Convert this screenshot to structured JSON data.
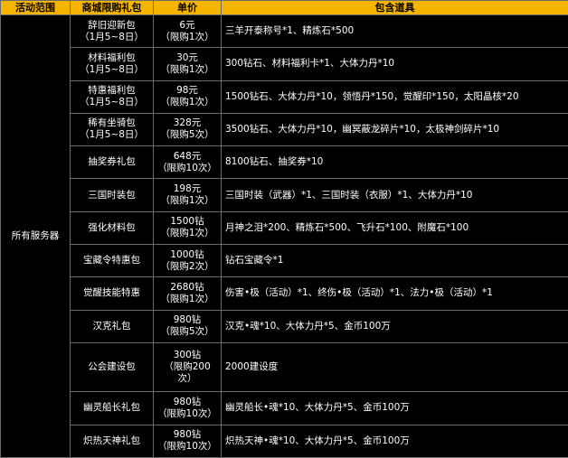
{
  "headers": [
    "活动范围",
    "商城限购礼包",
    "单价",
    "包含道具"
  ],
  "scope": "所有服务器",
  "rows": [
    {
      "name": [
        "辞旧迎新包",
        "（1月5~8日）"
      ],
      "price": [
        "6元",
        "（限购1次）"
      ],
      "items": "三羊开泰称号*1、精炼石*500"
    },
    {
      "name": [
        "材料福利包",
        "（1月5~8日）"
      ],
      "price": [
        "30元",
        "（限购1次）"
      ],
      "items": "300钻石、材料福利卡*1、大体力丹*10"
    },
    {
      "name": [
        "特惠福利包",
        "（1月5~8日）"
      ],
      "price": [
        "98元",
        "（限购1次）"
      ],
      "items": "1500钻石、大体力丹*10，领悟丹*150，觉醒印*150，太阳晶核*20"
    },
    {
      "name": [
        "稀有坐骑包",
        "（1月5~8日）"
      ],
      "price": [
        "328元",
        "（限购5次）"
      ],
      "items": "3500钻石、大体力丹*10，幽冥蔽龙碎片*10，太极神剑碎片*10"
    },
    {
      "name": [
        "抽奖券礼包"
      ],
      "price": [
        "648元",
        "（限购10次）"
      ],
      "items": "8100钻石、抽奖券*10"
    },
    {
      "name": [
        "三国时装包"
      ],
      "price": [
        "198元",
        "（限购1次）"
      ],
      "items": "三国时装（武器）*1、三国时装（衣服）*1、大体力丹*10"
    },
    {
      "name": [
        "强化材料包"
      ],
      "price": [
        "1500钻",
        "（限购1次）"
      ],
      "items": "月神之泪*200、精炼石*500、飞升石*100、附魔石*100"
    },
    {
      "name": [
        "宝藏令特惠包"
      ],
      "price": [
        "1000钻",
        "（限购2次）"
      ],
      "items": "钻石宝藏令*1"
    },
    {
      "name": [
        "觉醒技能特惠"
      ],
      "price": [
        "2680钻",
        "（限购1次）"
      ],
      "items": "伤害•极（活动）*1、终伤•极（活动）*1、法力•极（活动）*1"
    },
    {
      "name": [
        "汉克礼包"
      ],
      "price": [
        "980钻",
        "（限购5次）"
      ],
      "items": "汉克•魂*10、大体力丹*5、金币100万"
    },
    {
      "name": [
        "公会建设包"
      ],
      "price": [
        "300钻",
        "（限购200",
        "次）"
      ],
      "items": "2000建设度"
    },
    {
      "name": [
        "幽灵船长礼包"
      ],
      "price": [
        "980钻",
        "（限购10次）"
      ],
      "items": "幽灵船长•魂*10、大体力丹*5、金币100万"
    },
    {
      "name": [
        "炽热天神礼包"
      ],
      "price": [
        "980钻",
        "（限购10次）"
      ],
      "items": "炽热天神•魂*10、大体力丹*5、金币100万"
    }
  ]
}
